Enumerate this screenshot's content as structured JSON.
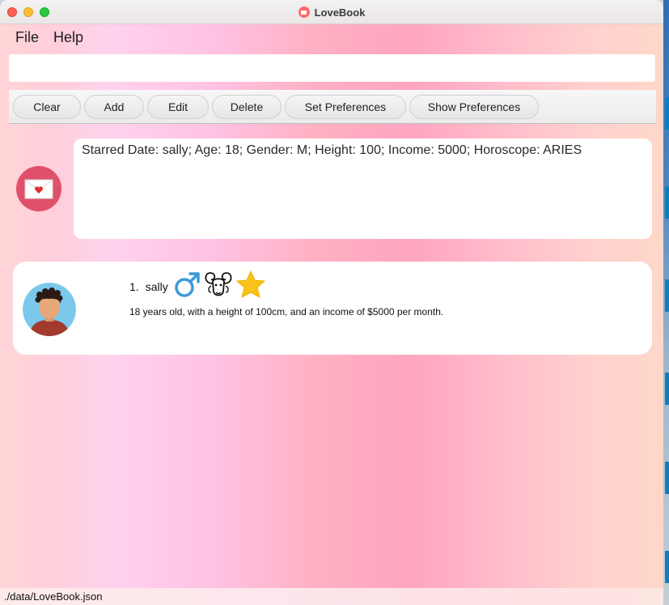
{
  "window": {
    "title": "LoveBook"
  },
  "menu": {
    "file_label": "File",
    "help_label": "Help"
  },
  "command": {
    "value": "",
    "placeholder": ""
  },
  "toolbar": {
    "buttons": [
      {
        "label": "Clear"
      },
      {
        "label": "Add"
      },
      {
        "label": "Edit"
      },
      {
        "label": "Delete"
      },
      {
        "label": "Set Preferences"
      },
      {
        "label": "Show Preferences"
      }
    ]
  },
  "result": {
    "icon": "love-letter-icon",
    "text": "Starred Date: sally; Age: 18; Gender: M; Height: 100; Income: 5000; Horoscope: ARIES"
  },
  "date_list": [
    {
      "index": "1.",
      "name": "sally",
      "gender_icon": "male-symbol-icon",
      "horoscope_icon": "aries-ram-icon",
      "starred_icon": "star-icon",
      "description": "18 years old, with a height of 100cm, and an income of $5000 per month.",
      "avatar": "person-avatar"
    }
  ],
  "status": {
    "path": "./data/LoveBook.json"
  },
  "colors": {
    "accent": "#e0506a",
    "male_symbol": "#3a9ad9",
    "star": "#f7c21a"
  }
}
